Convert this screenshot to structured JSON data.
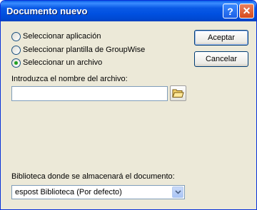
{
  "window": {
    "title": "Documento nuevo",
    "help_glyph": "?",
    "close_glyph": "✕"
  },
  "options": [
    {
      "label": "Seleccionar aplicación",
      "checked": false
    },
    {
      "label": "Seleccionar plantilla de GroupWise",
      "checked": false
    },
    {
      "label": "Seleccionar un archivo",
      "checked": true
    }
  ],
  "buttons": {
    "accept": "Aceptar",
    "cancel": "Cancelar"
  },
  "file": {
    "label": "Introduzca el nombre del archivo:",
    "value": "",
    "browse_icon": "folder-icon"
  },
  "library": {
    "label": "Biblioteca donde se almacenará el documento:",
    "selected": "espost Biblioteca  (Por defecto)"
  },
  "colors": {
    "titlebar": "#0054e3",
    "window_bg": "#ece9d8",
    "radio_selected": "#21a121"
  }
}
